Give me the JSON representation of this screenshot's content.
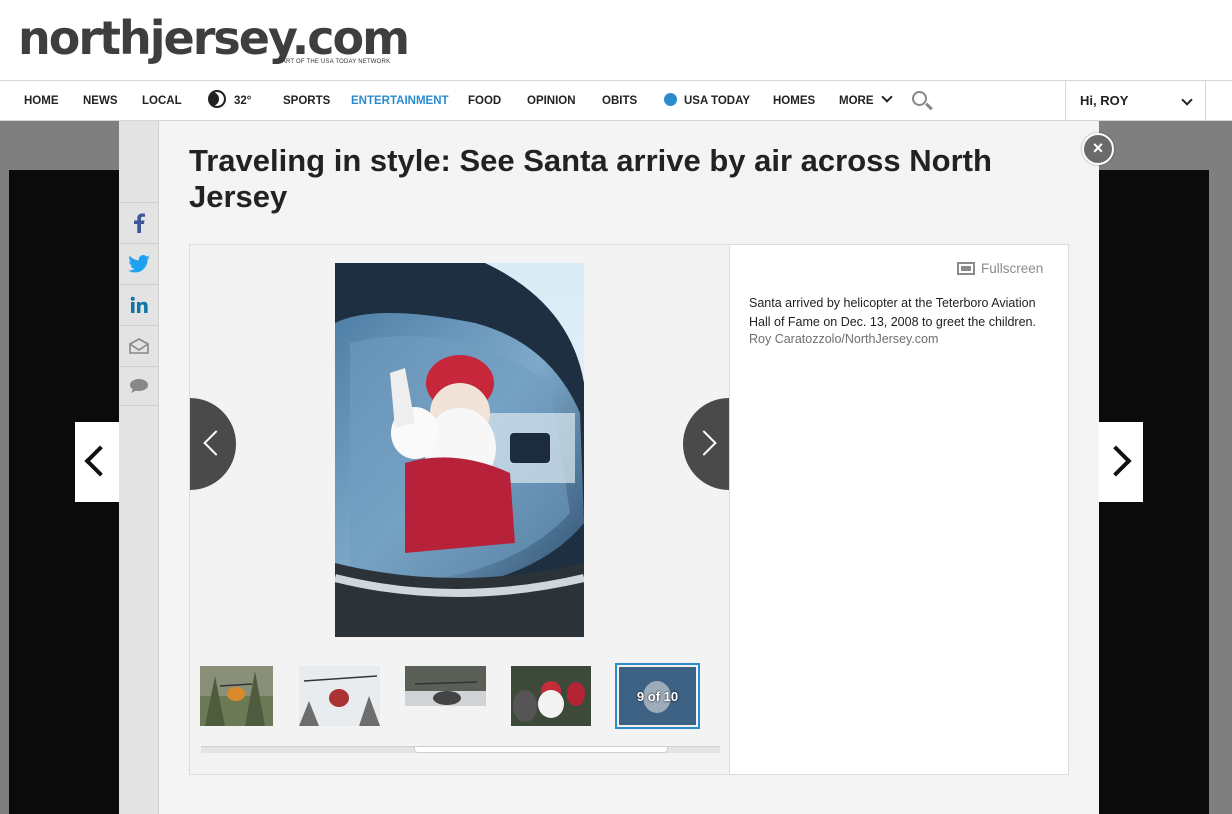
{
  "site": {
    "logo": "northjersey.com",
    "tagline": "PART OF THE USA TODAY NETWORK"
  },
  "nav": {
    "items": [
      {
        "label": "HOME"
      },
      {
        "label": "NEWS"
      },
      {
        "label": "LOCAL"
      },
      {
        "label": "32°",
        "icon": "weather-night-icon"
      },
      {
        "label": "SPORTS"
      },
      {
        "label": "ENTERTAINMENT",
        "active": true
      },
      {
        "label": "FOOD"
      },
      {
        "label": "OPINION"
      },
      {
        "label": "OBITS"
      },
      {
        "label": "USA TODAY",
        "icon": "usa-today-dot-icon"
      },
      {
        "label": "HOMES"
      },
      {
        "label": "MORE",
        "icon": "chevron-down-icon"
      }
    ],
    "search_icon": "search-icon",
    "user": "Hi, ROY",
    "accent_color": "#2a8ccc"
  },
  "gallery": {
    "title": "Traveling in style: See Santa arrive by air across North Jersey",
    "close_label": "×",
    "fullscreen_label": "Fullscreen",
    "caption": "Santa arrived by helicopter at the Teterboro Aviation Hall of Fame on Dec. 13, 2008 to greet the children.",
    "credit": "Roy Caratozzolo/NorthJersey.com",
    "current": 9,
    "total": 10,
    "position_label": "9 of 10",
    "thumbnails": [
      {
        "description": "helicopter-over-trees"
      },
      {
        "description": "helicopter-landing"
      },
      {
        "description": "helicopter-on-snow"
      },
      {
        "description": "santa-with-crowd"
      },
      {
        "description": "santa-in-cockpit",
        "selected": true
      }
    ]
  },
  "share": {
    "buttons": [
      "facebook-icon",
      "twitter-icon",
      "linkedin-icon",
      "email-icon",
      "comment-icon"
    ]
  }
}
